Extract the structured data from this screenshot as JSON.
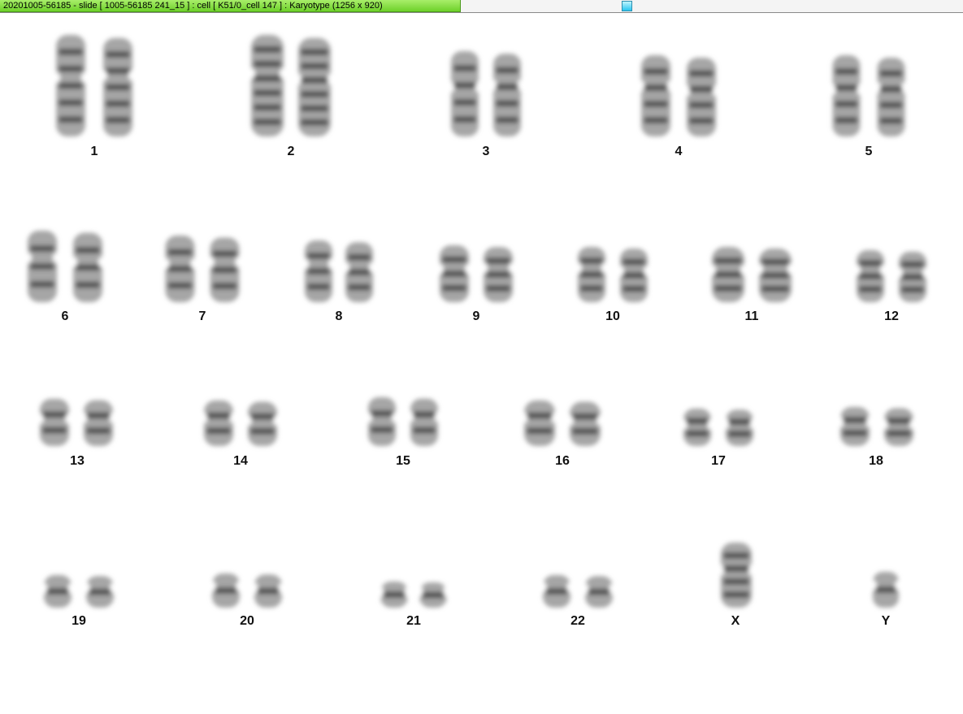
{
  "window": {
    "title": "20201005-56185 - slide [ 1005-56185 241_15 ] : cell [ K51/0_cell 147 ] : Karyotype  (1256 x 920)"
  },
  "karyotype": {
    "labels": [
      "1",
      "2",
      "3",
      "4",
      "5",
      "6",
      "7",
      "8",
      "9",
      "10",
      "11",
      "12",
      "13",
      "14",
      "15",
      "16",
      "17",
      "18",
      "19",
      "20",
      "21",
      "22",
      "X",
      "Y"
    ]
  },
  "colors": {
    "title_bar_green": "#7ed638",
    "scroll_thumb_cyan": "#28c6f0",
    "chromosome_gray": "#8c8c8c"
  }
}
